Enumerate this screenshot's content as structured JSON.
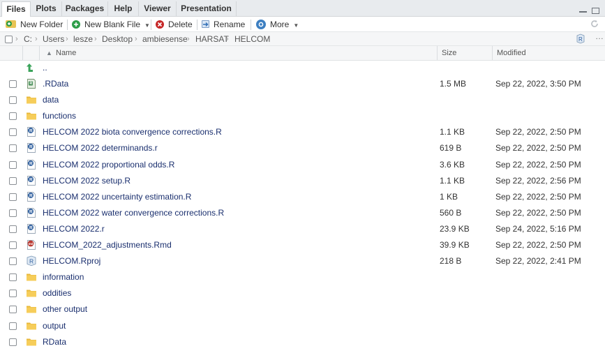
{
  "tabs": [
    {
      "label": "Files",
      "active": true
    },
    {
      "label": "Plots",
      "active": false
    },
    {
      "label": "Packages",
      "active": false
    },
    {
      "label": "Help",
      "active": false
    },
    {
      "label": "Viewer",
      "active": false
    },
    {
      "label": "Presentation",
      "active": false
    }
  ],
  "toolbar": {
    "new_folder": "New Folder",
    "new_blank_file": "New Blank File",
    "delete": "Delete",
    "rename": "Rename",
    "more": "More"
  },
  "path": [
    "C:",
    "Users",
    "lesze",
    "Desktop",
    "ambiesense",
    "HARSAT",
    "HELCOM"
  ],
  "columns": {
    "name": "Name",
    "sort_indicator": "▲",
    "size": "Size",
    "modified": "Modified"
  },
  "parent_dir": "..",
  "files": [
    {
      "name": ".RData",
      "type": "rdata",
      "size": "1.5 MB",
      "modified": "Sep 22, 2022, 3:50 PM"
    },
    {
      "name": "data",
      "type": "folder",
      "size": "",
      "modified": ""
    },
    {
      "name": "functions",
      "type": "folder",
      "size": "",
      "modified": ""
    },
    {
      "name": "HELCOM 2022 biota convergence corrections.R",
      "type": "r",
      "size": "1.1 KB",
      "modified": "Sep 22, 2022, 2:50 PM"
    },
    {
      "name": "HELCOM 2022 determinands.r",
      "type": "r",
      "size": "619 B",
      "modified": "Sep 22, 2022, 2:50 PM"
    },
    {
      "name": "HELCOM 2022 proportional odds.R",
      "type": "r",
      "size": "3.6 KB",
      "modified": "Sep 22, 2022, 2:50 PM"
    },
    {
      "name": "HELCOM 2022 setup.R",
      "type": "r",
      "size": "1.1 KB",
      "modified": "Sep 22, 2022, 2:56 PM"
    },
    {
      "name": "HELCOM 2022 uncertainty estimation.R",
      "type": "r",
      "size": "1 KB",
      "modified": "Sep 22, 2022, 2:50 PM"
    },
    {
      "name": "HELCOM 2022 water convergence corrections.R",
      "type": "r",
      "size": "560 B",
      "modified": "Sep 22, 2022, 2:50 PM"
    },
    {
      "name": "HELCOM 2022.r",
      "type": "r",
      "size": "23.9 KB",
      "modified": "Sep 24, 2022, 5:16 PM"
    },
    {
      "name": "HELCOM_2022_adjustments.Rmd",
      "type": "rmd",
      "size": "39.9 KB",
      "modified": "Sep 22, 2022, 2:50 PM"
    },
    {
      "name": "HELCOM.Rproj",
      "type": "rproj",
      "size": "218 B",
      "modified": "Sep 22, 2022, 2:41 PM"
    },
    {
      "name": "information",
      "type": "folder",
      "size": "",
      "modified": ""
    },
    {
      "name": "oddities",
      "type": "folder",
      "size": "",
      "modified": ""
    },
    {
      "name": "other output",
      "type": "folder",
      "size": "",
      "modified": ""
    },
    {
      "name": "output",
      "type": "folder",
      "size": "",
      "modified": ""
    },
    {
      "name": "RData",
      "type": "folder",
      "size": "",
      "modified": ""
    }
  ],
  "colors": {
    "folder": "#f2c94c",
    "r_icon": "#2f5f9e",
    "rmd_icon": "#c0392b",
    "link": "#1a2f6e",
    "up_arrow": "#3aa35a"
  }
}
